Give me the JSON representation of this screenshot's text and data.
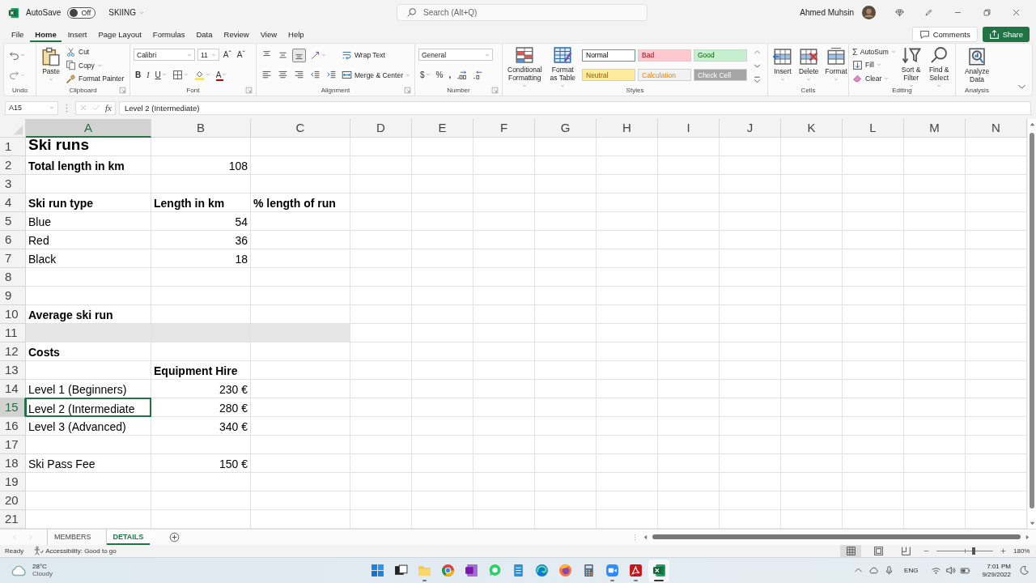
{
  "title_bar": {
    "autosave_label": "AutoSave",
    "autosave_toggle": {
      "label": "Off",
      "on": false
    },
    "file_name": "SKIING",
    "search": {
      "placeholder": "Search (Alt+Q)"
    },
    "user_name": "Ahmed Muhsin"
  },
  "menu_tabs": [
    {
      "label": "File",
      "selected": false
    },
    {
      "label": "Home",
      "selected": true
    },
    {
      "label": "Insert",
      "selected": false
    },
    {
      "label": "Page Layout",
      "selected": false
    },
    {
      "label": "Formulas",
      "selected": false
    },
    {
      "label": "Data",
      "selected": false
    },
    {
      "label": "Review",
      "selected": false
    },
    {
      "label": "View",
      "selected": false
    },
    {
      "label": "Help",
      "selected": false
    }
  ],
  "comments_button": "Comments",
  "share_button": "Share",
  "ribbon": [
    {
      "label": "Undo",
      "columns": [
        [
          [
            {
              "kind": "icon",
              "disabled": false
            }
          ],
          [
            {
              "kind": "icon",
              "disabled": true
            }
          ]
        ]
      ]
    },
    {
      "label": "Clipboard",
      "columns": [
        [
          [
            {
              "kind": "large",
              "label": "Paste"
            }
          ]
        ],
        [
          [
            {
              "kind": "small",
              "label": "Cut"
            }
          ],
          [
            {
              "kind": "small",
              "label": "Copy"
            }
          ],
          [
            {
              "kind": "small",
              "label": "Format Painter"
            }
          ]
        ]
      ]
    },
    {
      "label": "Font",
      "columns": [
        [
          [
            {
              "kind": "combo",
              "value": "Calibri"
            },
            {
              "kind": "combo",
              "value": "11"
            },
            {
              "kind": "glyph",
              "label": "Aˆ"
            },
            {
              "kind": "glyph",
              "label": "Aˇ"
            }
          ],
          [
            {
              "kind": "glyph",
              "label": "B"
            },
            {
              "kind": "glyph",
              "label": "I"
            },
            {
              "kind": "glyph",
              "label": "U"
            },
            {
              "kind": "icon",
              "disabled": false
            },
            {
              "kind": "icon",
              "disabled": false
            },
            {
              "kind": "glyph",
              "label": "A"
            }
          ]
        ]
      ]
    },
    {
      "label": "Alignment",
      "columns": [
        [
          [
            {
              "kind": "icon",
              "disabled": false,
              "on": false
            },
            {
              "kind": "icon",
              "disabled": false,
              "on": false
            },
            {
              "kind": "icon",
              "disabled": false,
              "on": true
            },
            {
              "kind": "icon",
              "disabled": false,
              "on": false
            }
          ],
          [
            {
              "kind": "icon",
              "disabled": false
            },
            {
              "kind": "icon",
              "disabled": false
            },
            {
              "kind": "icon",
              "disabled": false
            },
            {
              "kind": "icon",
              "disabled": false
            },
            {
              "kind": "icon",
              "disabled": false
            }
          ]
        ],
        [
          [
            {
              "kind": "small",
              "label": "Wrap Text"
            }
          ],
          [
            {
              "kind": "small",
              "label": "Merge & Center"
            }
          ]
        ]
      ]
    },
    {
      "label": "Number",
      "columns": [
        [
          [
            {
              "kind": "combo",
              "value": "General"
            }
          ],
          [
            {
              "kind": "glyph",
              "label": "$"
            },
            {
              "kind": "glyph",
              "label": "%"
            },
            {
              "kind": "glyph",
              "label": ","
            },
            {
              "kind": "icon",
              "disabled": false
            },
            {
              "kind": "icon",
              "disabled": false
            }
          ]
        ]
      ]
    },
    {
      "label": "Styles",
      "columns": [
        [
          [
            {
              "kind": "large",
              "label": "Conditional Formatting"
            }
          ]
        ],
        [
          [
            {
              "kind": "large",
              "label": "Format as Table"
            }
          ]
        ],
        [
          [
            {
              "kind": "style",
              "label": "Normal",
              "color": "#ffffff",
              "selected": true
            },
            {
              "kind": "style",
              "label": "Bad",
              "color": "#ffc7ce",
              "selected": false
            },
            {
              "kind": "style",
              "label": "Good",
              "color": "#c6efce",
              "selected": false
            }
          ],
          [
            {
              "kind": "style",
              "label": "Neutral",
              "color": "#ffeb9c",
              "selected": false
            },
            {
              "kind": "style",
              "label": "Calculation",
              "color": "#f2f2f2",
              "selected": false
            },
            {
              "kind": "style",
              "label": "Check Cell",
              "color": "#a5a5a5",
              "selected": false
            }
          ]
        ],
        [
          [
            {
              "kind": "icon",
              "disabled": true
            }
          ],
          [
            {
              "kind": "icon",
              "disabled": false
            }
          ],
          [
            {
              "kind": "icon",
              "disabled": false
            }
          ]
        ]
      ]
    },
    {
      "label": "Cells",
      "columns": [
        [
          [
            {
              "kind": "large",
              "label": "Insert"
            }
          ]
        ],
        [
          [
            {
              "kind": "large",
              "label": "Delete"
            }
          ]
        ],
        [
          [
            {
              "kind": "large",
              "label": "Format"
            }
          ]
        ]
      ]
    },
    {
      "label": "Editing",
      "columns": [
        [
          [
            {
              "kind": "small",
              "label": "AutoSum",
              "symbol": "Σ"
            }
          ],
          [
            {
              "kind": "small",
              "label": "Fill"
            }
          ],
          [
            {
              "kind": "small",
              "label": "Clear"
            }
          ]
        ],
        [
          [
            {
              "kind": "large",
              "label": "Sort & Filter"
            }
          ]
        ],
        [
          [
            {
              "kind": "large",
              "label": "Find & Select"
            }
          ]
        ]
      ]
    },
    {
      "label": "Analysis",
      "columns": [
        [
          [
            {
              "kind": "large",
              "label": "Analyze Data"
            }
          ]
        ]
      ]
    }
  ],
  "formula_bar": {
    "name_box": "A15",
    "function_label": "fx",
    "formula": "Level 2 (Intermediate)"
  },
  "sheet": {
    "columns": [
      {
        "label": "A",
        "selected": true
      },
      {
        "label": "B",
        "selected": false
      },
      {
        "label": "C",
        "selected": false
      },
      {
        "label": "D",
        "selected": false
      },
      {
        "label": "E",
        "selected": false
      },
      {
        "label": "F",
        "selected": false
      },
      {
        "label": "G",
        "selected": false
      },
      {
        "label": "H",
        "selected": false
      },
      {
        "label": "I",
        "selected": false
      },
      {
        "label": "J",
        "selected": false
      },
      {
        "label": "K",
        "selected": false
      },
      {
        "label": "L",
        "selected": false
      },
      {
        "label": "M",
        "selected": false
      },
      {
        "label": "N",
        "selected": false
      }
    ],
    "rows": [
      {
        "number": "1",
        "selected": false,
        "shaded": false,
        "col_a": {
          "text": "Ski runs",
          "kind": "title",
          "selected": false
        }
      },
      {
        "number": "2",
        "selected": false,
        "shaded": false,
        "col_a": {
          "text": "Total length in km",
          "kind": "heading",
          "selected": false
        },
        "col_b": {
          "text": "108",
          "kind": "number",
          "selected": false
        }
      },
      {
        "number": "3",
        "selected": false,
        "shaded": false
      },
      {
        "number": "4",
        "selected": false,
        "shaded": false,
        "col_a": {
          "text": "Ski run type",
          "kind": "heading",
          "selected": false
        },
        "col_b": {
          "text": "Length in km",
          "kind": "heading",
          "selected": false
        },
        "col_c": {
          "text": "% length of run",
          "kind": "heading",
          "selected": false
        }
      },
      {
        "number": "5",
        "selected": false,
        "shaded": false,
        "col_a": {
          "text": "Blue",
          "kind": "text",
          "selected": false
        },
        "col_b": {
          "text": "54",
          "kind": "number",
          "selected": false
        }
      },
      {
        "number": "6",
        "selected": false,
        "shaded": false,
        "col_a": {
          "text": "Red",
          "kind": "text",
          "selected": false
        },
        "col_b": {
          "text": "36",
          "kind": "number",
          "selected": false
        }
      },
      {
        "number": "7",
        "selected": false,
        "shaded": false,
        "col_a": {
          "text": "Black",
          "kind": "text",
          "selected": false
        },
        "col_b": {
          "text": "18",
          "kind": "number",
          "selected": false
        }
      },
      {
        "number": "8",
        "selected": false,
        "shaded": false
      },
      {
        "number": "9",
        "selected": false,
        "shaded": false
      },
      {
        "number": "10",
        "selected": false,
        "shaded": false,
        "col_a": {
          "text": "Average ski run",
          "kind": "heading",
          "selected": false
        }
      },
      {
        "number": "11",
        "selected": false,
        "shaded": true
      },
      {
        "number": "12",
        "selected": false,
        "shaded": false,
        "col_a": {
          "text": "Costs",
          "kind": "heading",
          "selected": false
        }
      },
      {
        "number": "13",
        "selected": false,
        "shaded": false,
        "col_b": {
          "text": "Equipment Hire",
          "kind": "heading",
          "selected": false
        }
      },
      {
        "number": "14",
        "selected": false,
        "shaded": false,
        "col_a": {
          "text": "Level 1 (Beginners)",
          "kind": "text",
          "selected": false
        },
        "col_b": {
          "text": "230 €",
          "kind": "number",
          "selected": false
        }
      },
      {
        "number": "15",
        "selected": true,
        "shaded": false,
        "col_a": {
          "text": "Level 2 (Intermediate",
          "kind": "text",
          "selected": true
        },
        "col_b": {
          "text": "280 €",
          "kind": "number",
          "selected": false
        }
      },
      {
        "number": "16",
        "selected": false,
        "shaded": false,
        "col_a": {
          "text": "Level 3 (Advanced)",
          "kind": "text",
          "selected": false
        },
        "col_b": {
          "text": "340 €",
          "kind": "number",
          "selected": false
        }
      },
      {
        "number": "17",
        "selected": false,
        "shaded": false
      },
      {
        "number": "18",
        "selected": false,
        "shaded": false,
        "col_a": {
          "text": "Ski Pass Fee",
          "kind": "text",
          "selected": false
        },
        "col_b": {
          "text": "150 €",
          "kind": "number",
          "selected": false
        }
      },
      {
        "number": "19",
        "selected": false,
        "shaded": false
      },
      {
        "number": "20",
        "selected": false,
        "shaded": false
      },
      {
        "number": "21",
        "selected": false,
        "shaded": false
      }
    ]
  },
  "sheet_tabs": [
    {
      "label": "MEMBERS",
      "selected": false
    },
    {
      "label": "DETAILS",
      "selected": true
    }
  ],
  "status_bar": {
    "mode": "Ready",
    "accessibility": "Accessibility: Good to go",
    "views": [
      {
        "selected": true
      },
      {
        "selected": false
      },
      {
        "selected": false
      }
    ],
    "zoom": {
      "level": 0.65,
      "reading": "180%"
    }
  },
  "taskbar": {
    "weather": {
      "temperature": "28°C",
      "condition": "Cloudy"
    },
    "apps": [
      {
        "running": false,
        "selected": false
      },
      {
        "running": false,
        "selected": false
      },
      {
        "running": true,
        "selected": false
      },
      {
        "running": false,
        "selected": false
      },
      {
        "running": false,
        "selected": false
      },
      {
        "running": false,
        "selected": false
      },
      {
        "running": false,
        "selected": false
      },
      {
        "running": false,
        "selected": false
      },
      {
        "running": false,
        "selected": false
      },
      {
        "running": false,
        "selected": false
      },
      {
        "running": true,
        "selected": false
      },
      {
        "running": true,
        "selected": false
      },
      {
        "running": true,
        "selected": true
      }
    ],
    "language": "ENG",
    "time": "7:01 PM",
    "date": "9/29/2022"
  }
}
